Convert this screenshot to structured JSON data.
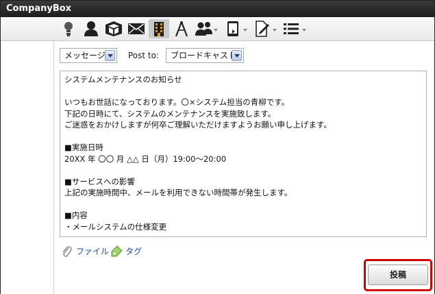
{
  "window": {
    "title": "CompanyBox"
  },
  "toolbar": {
    "icons": [
      "lightbulb-icon",
      "person-icon",
      "cube-icon",
      "mail-icon",
      "building-icon",
      "compass-icon",
      "group-icon",
      "tablet-icon",
      "document-edit-icon",
      "list-icon"
    ],
    "active": "building-icon"
  },
  "form": {
    "type_select": {
      "value": "メッセージ"
    },
    "post_to_label": "Post to:",
    "target_select": {
      "value": "ブロードキャスト"
    },
    "message_lines": [
      "システムメンテナンスのお知らせ",
      "",
      "いつもお世話になっております。〇×システム担当の青柳です。",
      "下記の日時にて、システムのメンテナンスを実施致します。",
      "ご迷惑をおかけしますが何卒ご理解いただけますようお願い申し上げます。",
      "",
      "■実施日時",
      "20XX 年 〇〇 月 △△ 日（月）19:00～20:00",
      "",
      "■サービスへの影響",
      "上記の実施時間中、メールを利用できない時間帯が発生します。",
      "",
      "■内容",
      "・メールシステムの仕様変更"
    ],
    "file_link": "ファイル",
    "tag_link": "タグ",
    "post_button": "投稿"
  },
  "colors": {
    "highlight": "#d10000",
    "link": "#1a4f9c",
    "titlebar": "#2a2a2a"
  }
}
